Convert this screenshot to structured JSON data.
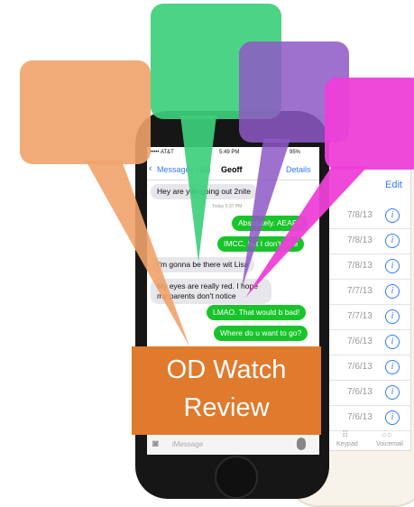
{
  "banner": {
    "line1": "OD Watch",
    "line2": "Review"
  },
  "colors": {
    "orange_callout": "#f0a26a",
    "green_callout": "#3ecf7c",
    "purple_callout": "#8e58c6",
    "magenta_callout": "#ee3fd8",
    "banner": "#e07a2c"
  },
  "phone": {
    "status": {
      "carrier": "••••• AT&T",
      "time": "5:49 PM",
      "battery": "95%"
    },
    "nav": {
      "back_label": "Messages (16)",
      "title": "Geoff",
      "details_label": "Details"
    },
    "timestamp": "Today 5:37 PM",
    "messages": [
      {
        "dir": "in",
        "text": "Hey are you going out 2nite"
      },
      {
        "dir": "out",
        "text": "Absolutely. AEAP!!"
      },
      {
        "dir": "out",
        "text": "IMCC, but I don't care"
      },
      {
        "dir": "in",
        "text": "I'm gonna be there wit Lisa"
      },
      {
        "dir": "in",
        "text": "My eyes are really red. I hope my parents don't notice"
      },
      {
        "dir": "out",
        "text": "LMAO. That would b bad!"
      },
      {
        "dir": "out",
        "text": "Where do u want to go?"
      }
    ],
    "input_placeholder": "iMessage"
  },
  "back_phone": {
    "edit_label": "Edit",
    "dates": [
      "7/8/13",
      "7/8/13",
      "7/8/13",
      "7/7/13",
      "7/7/13",
      "7/6/13",
      "7/6/13",
      "7/6/13",
      "7/6/13"
    ],
    "tabs": [
      "Keypad",
      "Voicemail"
    ]
  }
}
